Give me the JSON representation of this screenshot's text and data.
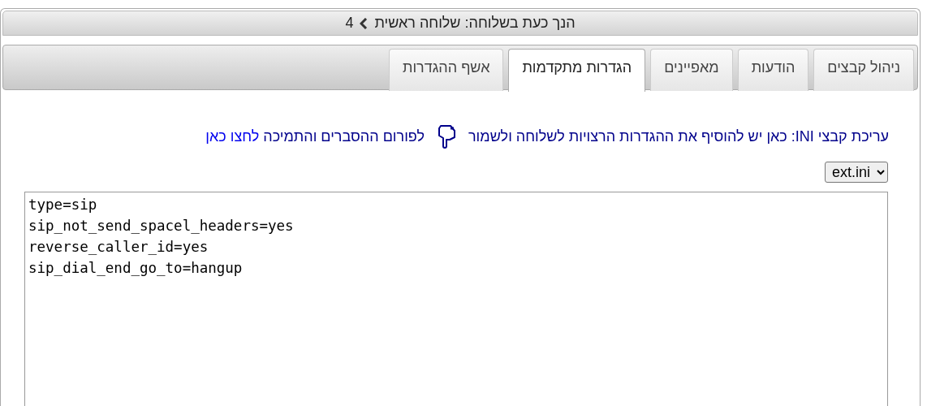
{
  "header": {
    "label": "הנך כעת בשלוחה: שלוחה ראשית",
    "extension": "4"
  },
  "tabs": [
    {
      "label": "ניהול קבצים",
      "selected": false
    },
    {
      "label": "הודעות",
      "selected": false
    },
    {
      "label": "מאפיינים",
      "selected": false
    },
    {
      "label": "הגדרות מתקדמות",
      "selected": true
    },
    {
      "label": "אשף ההגדרות",
      "selected": false
    }
  ],
  "instructions": {
    "text": "עריכת קבצי INI: כאן יש להוסיף את ההגדרות הרצויות לשלוחה ולשמור",
    "forum_text": "לפורום ההסברים והתמיכה",
    "forum_link": "לחצו כאן"
  },
  "file_select": {
    "value": "ext.ini"
  },
  "editor": {
    "lines": [
      "type=sip",
      "sip_not_send_spacel_headers=yes",
      "reverse_caller_id=yes",
      "sip_dial_end_go_to=hangup"
    ]
  }
}
